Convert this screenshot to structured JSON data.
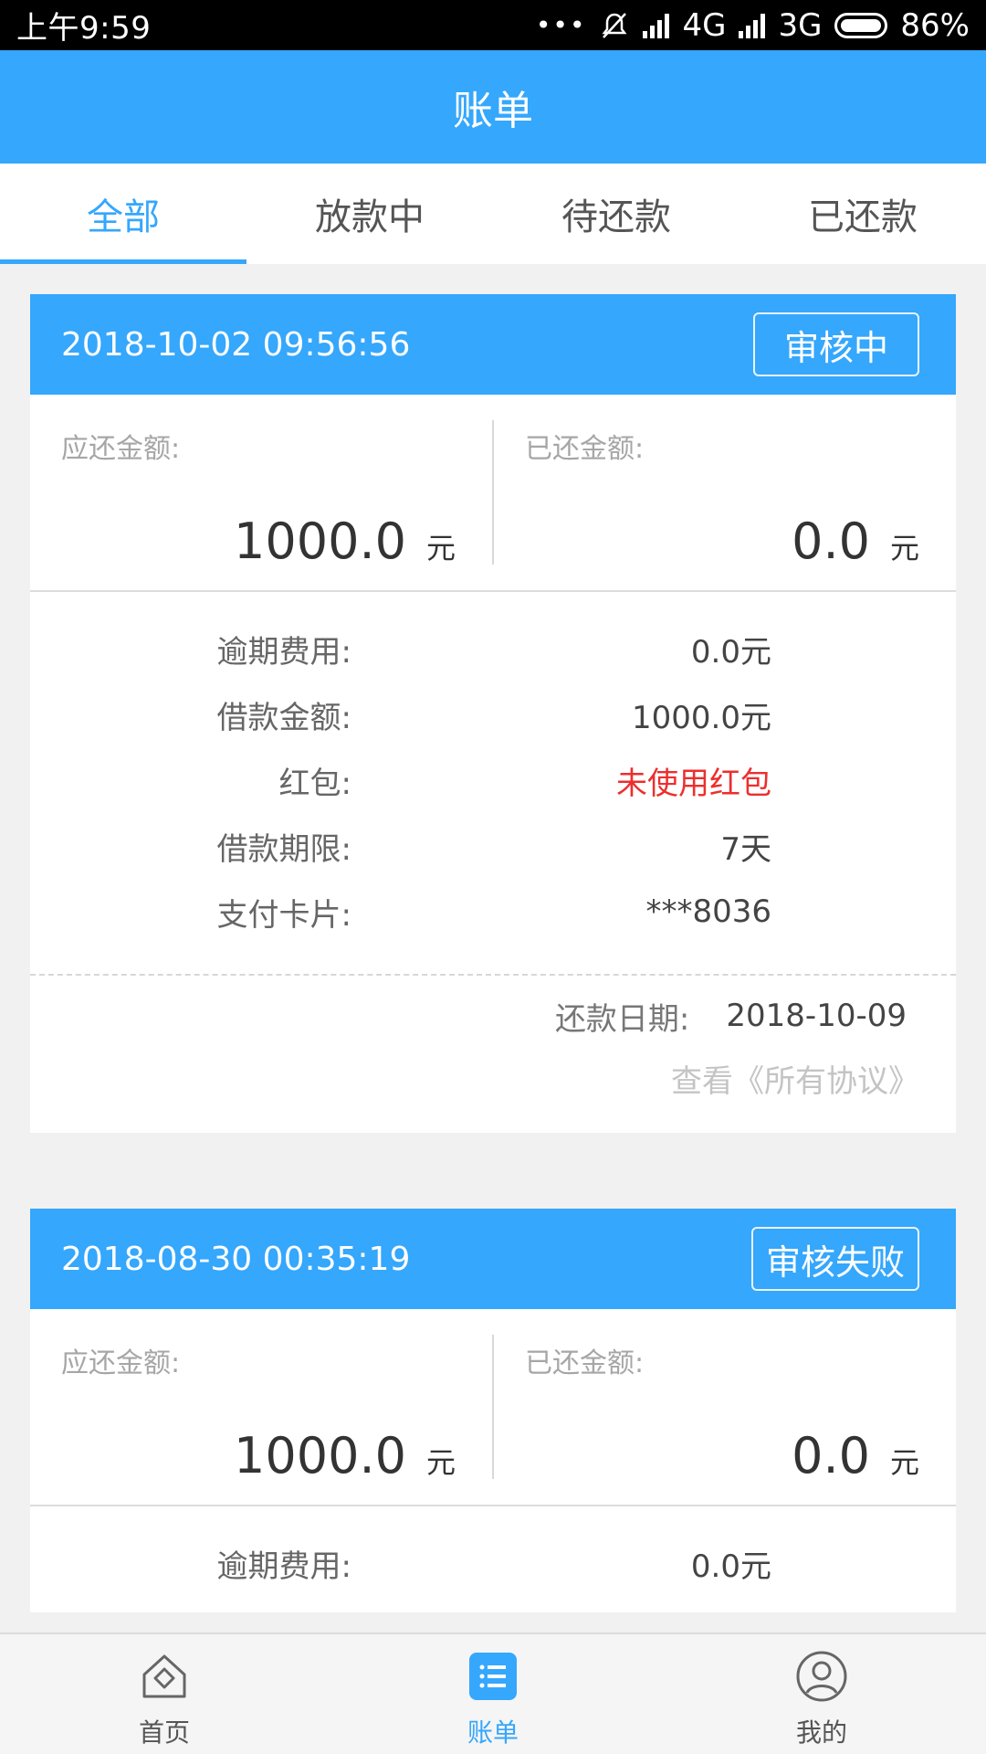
{
  "status_bar": {
    "time": "上午9:59",
    "net1": "4G",
    "net2": "3G",
    "battery": "86%"
  },
  "header": {
    "title": "账单"
  },
  "tabs": [
    {
      "label": "全部",
      "active": true
    },
    {
      "label": "放款中",
      "active": false
    },
    {
      "label": "待还款",
      "active": false
    },
    {
      "label": "已还款",
      "active": false
    }
  ],
  "colors": {
    "accent": "#35a7fc",
    "red": "#ed2e2e"
  },
  "bills": [
    {
      "datetime": "2018-10-02 09:56:56",
      "status": "审核中",
      "due_label": "应还金额:",
      "due_amount": "1000.0",
      "paid_label": "已还金额:",
      "paid_amount": "0.0",
      "unit": "元",
      "details": [
        {
          "label": "逾期费用:",
          "value": "0.0元"
        },
        {
          "label": "借款金额:",
          "value": "1000.0元"
        },
        {
          "label": "红包:",
          "value": "未使用红包"
        },
        {
          "label": "借款期限:",
          "value": "7天"
        },
        {
          "label": "支付卡片:",
          "value": "***8036"
        }
      ],
      "repay_label": "还款日期:",
      "repay_date": "2018-10-09",
      "agreement_link": "查看《所有协议》"
    },
    {
      "datetime": "2018-08-30 00:35:19",
      "status": "审核失败",
      "due_label": "应还金额:",
      "due_amount": "1000.0",
      "paid_label": "已还金额:",
      "paid_amount": "0.0",
      "unit": "元",
      "details": [
        {
          "label": "逾期费用:",
          "value": "0.0元"
        }
      ]
    }
  ],
  "bottom_nav": [
    {
      "label": "首页",
      "icon": "home-icon"
    },
    {
      "label": "账单",
      "icon": "bill-list-icon"
    },
    {
      "label": "我的",
      "icon": "profile-icon"
    }
  ]
}
